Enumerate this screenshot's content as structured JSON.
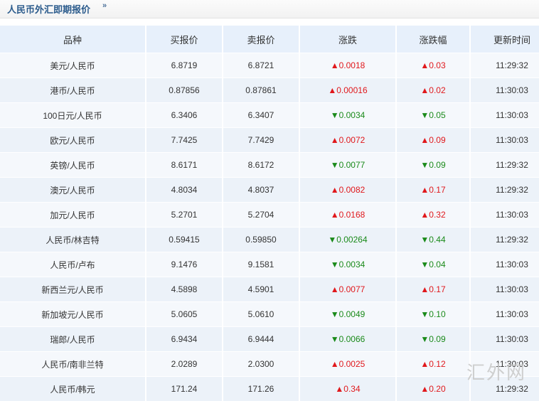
{
  "header": {
    "title": "人民币外汇即期报价",
    "caret": "»"
  },
  "columns": [
    "品种",
    "买报价",
    "卖报价",
    "涨跌",
    "涨跌幅",
    "更新时间"
  ],
  "rows": [
    {
      "pair": "美元/人民币",
      "bid": "6.8719",
      "ask": "6.8721",
      "dir": "up",
      "change": "0.0018",
      "pct": "0.03",
      "time": "11:29:32"
    },
    {
      "pair": "港币/人民币",
      "bid": "0.87856",
      "ask": "0.87861",
      "dir": "up",
      "change": "0.00016",
      "pct": "0.02",
      "time": "11:30:03"
    },
    {
      "pair": "100日元/人民币",
      "bid": "6.3406",
      "ask": "6.3407",
      "dir": "down",
      "change": "0.0034",
      "pct": "0.05",
      "time": "11:30:03"
    },
    {
      "pair": "欧元/人民币",
      "bid": "7.7425",
      "ask": "7.7429",
      "dir": "up",
      "change": "0.0072",
      "pct": "0.09",
      "time": "11:30:03"
    },
    {
      "pair": "英镑/人民币",
      "bid": "8.6171",
      "ask": "8.6172",
      "dir": "down",
      "change": "0.0077",
      "pct": "0.09",
      "time": "11:29:32"
    },
    {
      "pair": "澳元/人民币",
      "bid": "4.8034",
      "ask": "4.8037",
      "dir": "up",
      "change": "0.0082",
      "pct": "0.17",
      "time": "11:29:32"
    },
    {
      "pair": "加元/人民币",
      "bid": "5.2701",
      "ask": "5.2704",
      "dir": "up",
      "change": "0.0168",
      "pct": "0.32",
      "time": "11:30:03"
    },
    {
      "pair": "人民币/林吉特",
      "bid": "0.59415",
      "ask": "0.59850",
      "dir": "down",
      "change": "0.00264",
      "pct": "0.44",
      "time": "11:29:32"
    },
    {
      "pair": "人民币/卢布",
      "bid": "9.1476",
      "ask": "9.1581",
      "dir": "down",
      "change": "0.0034",
      "pct": "0.04",
      "time": "11:30:03"
    },
    {
      "pair": "新西兰元/人民币",
      "bid": "4.5898",
      "ask": "4.5901",
      "dir": "up",
      "change": "0.0077",
      "pct": "0.17",
      "time": "11:30:03"
    },
    {
      "pair": "新加坡元/人民币",
      "bid": "5.0605",
      "ask": "5.0610",
      "dir": "down",
      "change": "0.0049",
      "pct": "0.10",
      "time": "11:30:03"
    },
    {
      "pair": "瑞郎/人民币",
      "bid": "6.9434",
      "ask": "6.9444",
      "dir": "down",
      "change": "0.0066",
      "pct": "0.09",
      "time": "11:30:03"
    },
    {
      "pair": "人民币/南非兰特",
      "bid": "2.0289",
      "ask": "2.0300",
      "dir": "up",
      "change": "0.0025",
      "pct": "0.12",
      "time": "11:30:03"
    },
    {
      "pair": "人民币/韩元",
      "bid": "171.24",
      "ask": "171.26",
      "dir": "up",
      "change": "0.34",
      "pct": "0.20",
      "time": "11:29:32"
    }
  ],
  "arrows": {
    "up": "▲",
    "down": "▼"
  },
  "colors": {
    "up": "#e0181c",
    "down": "#1a8a1a",
    "header_bg": "#e7f0fb",
    "title": "#2b5b8c"
  },
  "watermark": "汇外网"
}
